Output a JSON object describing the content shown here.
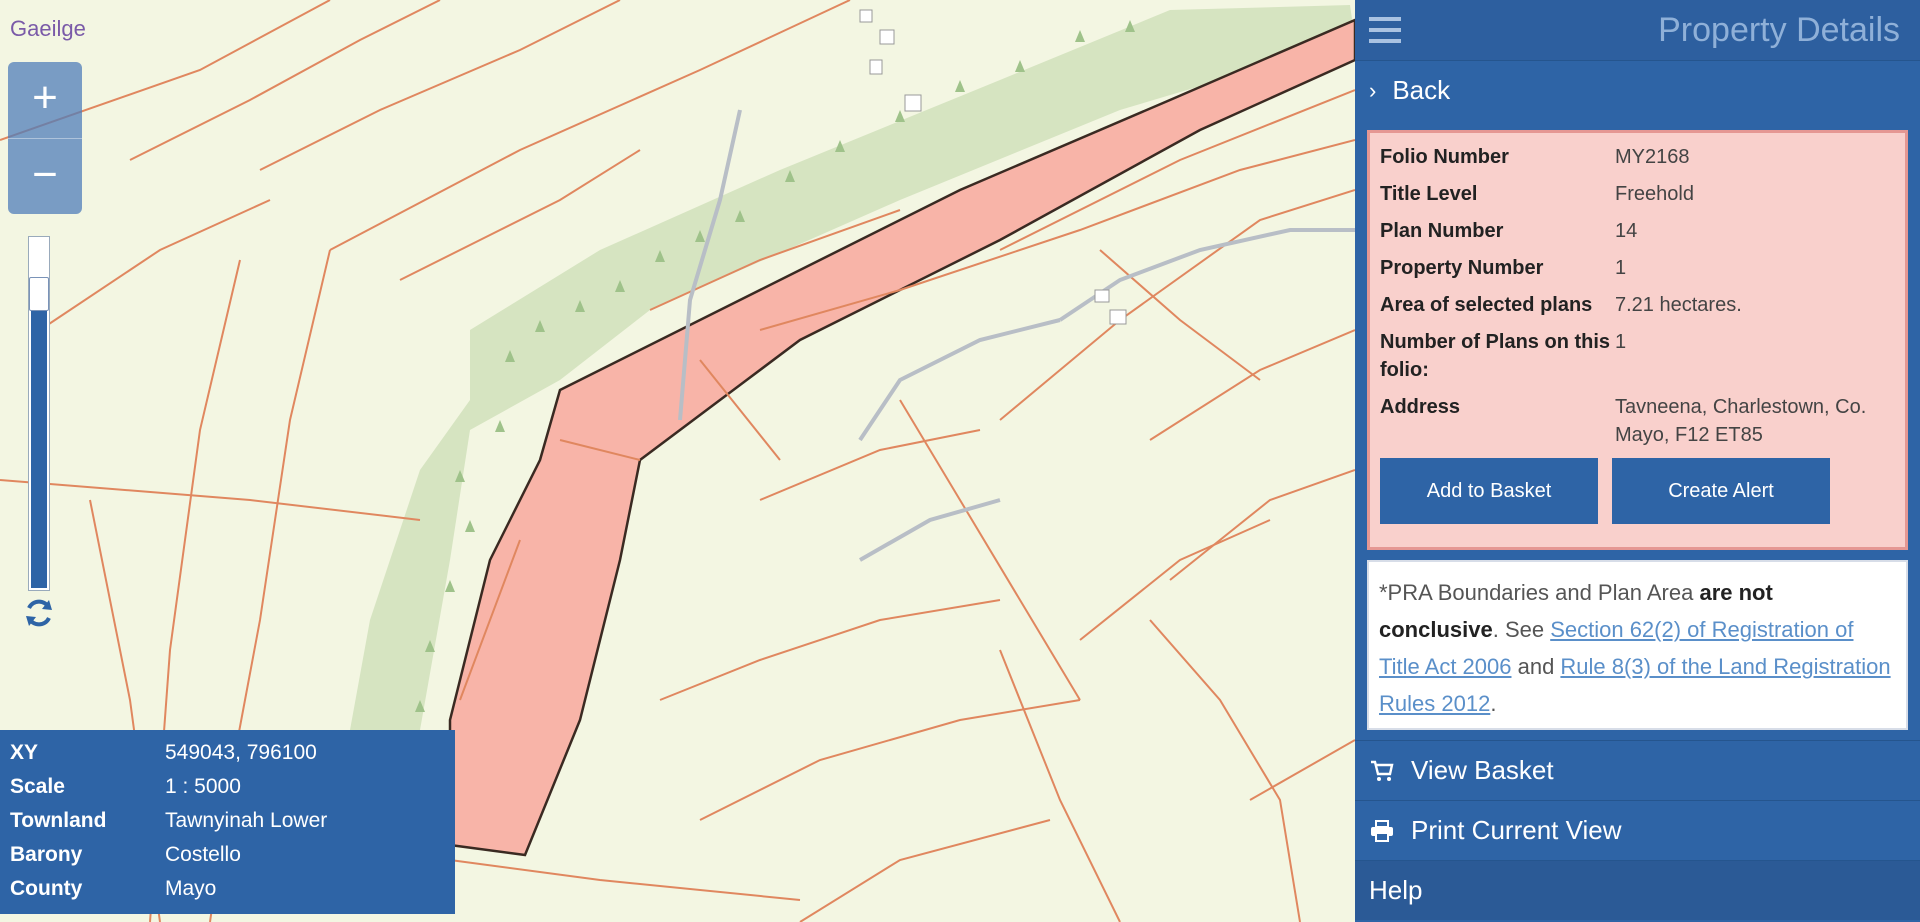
{
  "map": {
    "language_link": "Gaeilge",
    "zoom_in": "+",
    "zoom_out": "−",
    "info": [
      {
        "key": "XY",
        "value": "549043, 796100"
      },
      {
        "key": "Scale",
        "value": "1 : 5000"
      },
      {
        "key": "Townland",
        "value": "Tawnyinah Lower"
      },
      {
        "key": "Barony",
        "value": "Costello"
      },
      {
        "key": "County",
        "value": "Mayo"
      }
    ],
    "colors": {
      "background": "#f3f6e2",
      "boundary": "#e0875f",
      "forest": "#d6e4c1",
      "selected_parcel": "#f8b4a8",
      "road": "#b8bec6"
    }
  },
  "panel": {
    "title": "Property Details",
    "back_label": "Back",
    "details": [
      {
        "key": "Folio Number",
        "value": "MY2168"
      },
      {
        "key": "Title Level",
        "value": "Freehold"
      },
      {
        "key": "Plan Number",
        "value": "14"
      },
      {
        "key": "Property Number",
        "value": "1"
      },
      {
        "key": "Area of selected plans",
        "value": "7.21 hectares."
      },
      {
        "key": "Number of Plans on this folio:",
        "value": "1"
      },
      {
        "key": "Address",
        "value": "Tavneena, Charlestown, Co. Mayo, F12 ET85"
      }
    ],
    "add_to_basket": "Add to Basket",
    "create_alert": "Create Alert",
    "disclaimer": {
      "prefix": "*PRA Boundaries and Plan Area ",
      "bold": "are not conclusive",
      "mid": ". See ",
      "link1": "Section 62(2) of Registration of Title Act 2006",
      "and": " and ",
      "link2": "Rule 8(3) of the Land Registration Rules 2012",
      "suffix": "."
    },
    "view_basket": "View Basket",
    "print_view": "Print Current View",
    "help": "Help",
    "colors": {
      "panel": "#2e64a6",
      "details_bg": "#f9d0cc",
      "details_border": "#e59793"
    }
  }
}
